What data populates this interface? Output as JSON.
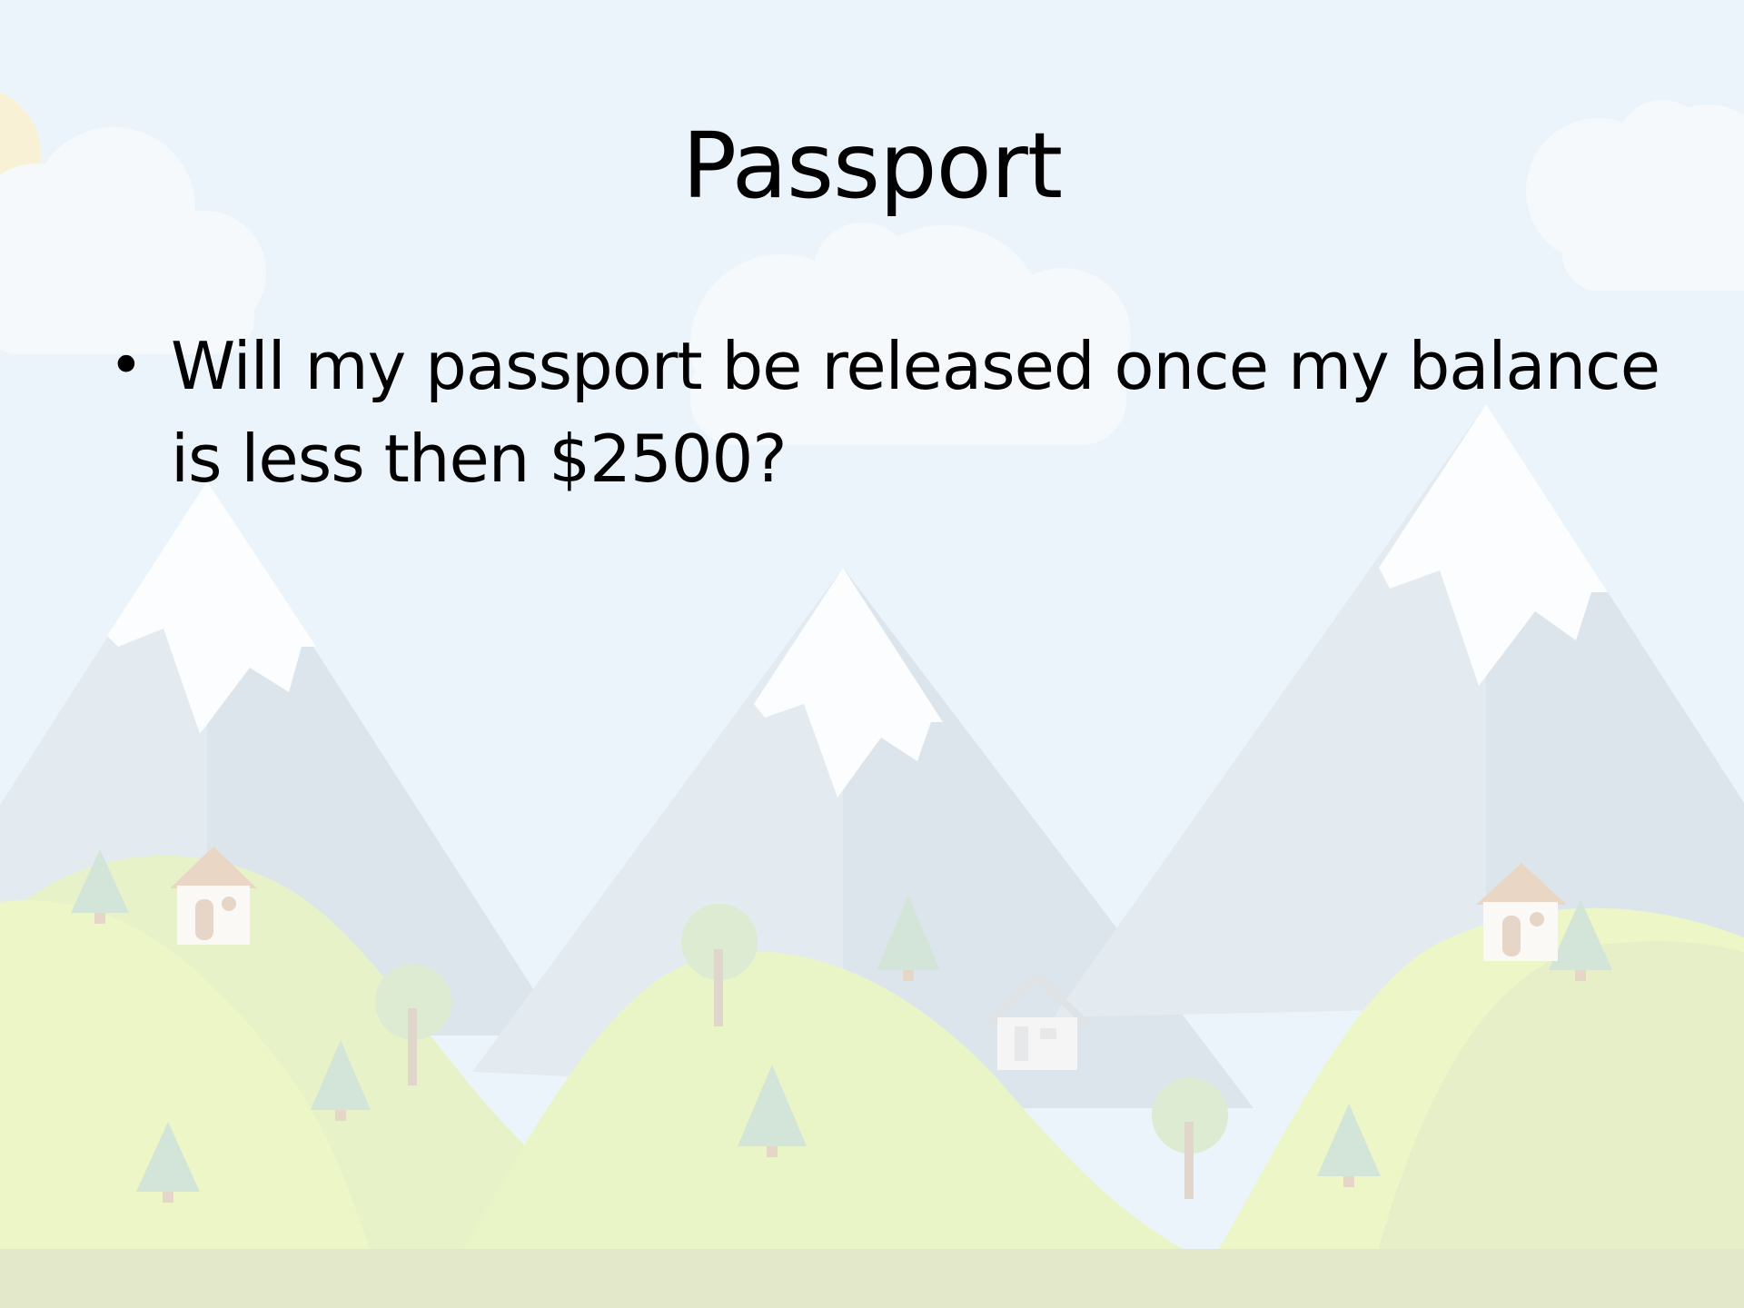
{
  "slide": {
    "title": "Passport",
    "bullets": [
      {
        "text": "Will my passport be released once my balance is less then $2500?"
      }
    ]
  },
  "colors": {
    "sky": "#ecf4fb",
    "mountain": "#e1e9f0",
    "snow": "#fbfdfe",
    "hill": "#eaf6c9",
    "ground": "#e5e9cc",
    "tree": "#d3e5d8",
    "house_roof": "#e6d6c8",
    "cloud": "#f6fafd",
    "text": "#000000"
  }
}
